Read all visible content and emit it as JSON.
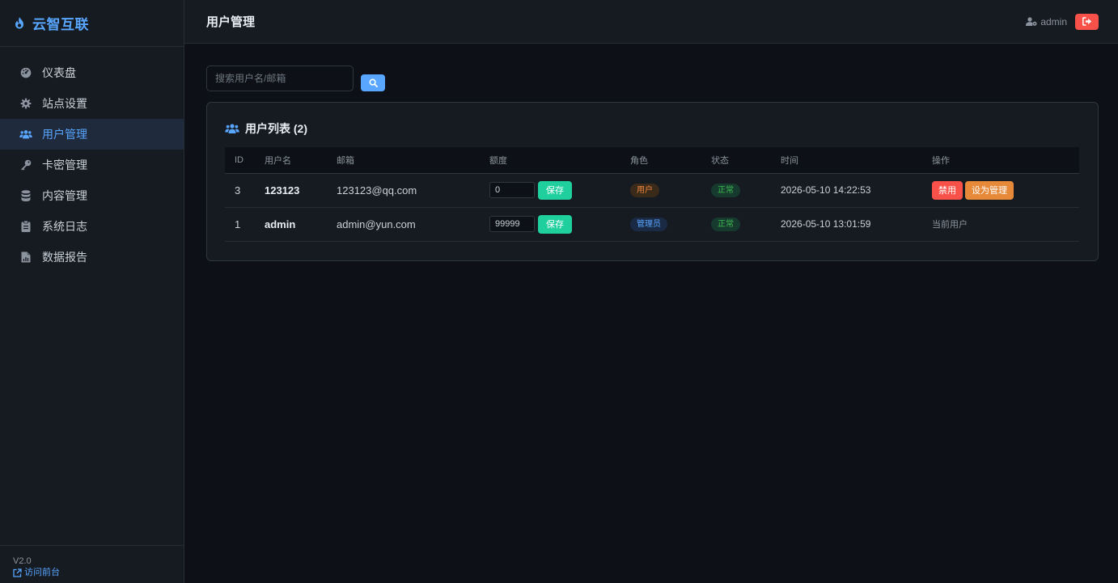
{
  "brand": {
    "name": "云智互联"
  },
  "sidebar": {
    "items": [
      {
        "label": "仪表盘",
        "icon": "dashboard-icon",
        "active": false
      },
      {
        "label": "站点设置",
        "icon": "gear-icon",
        "active": false
      },
      {
        "label": "用户管理",
        "icon": "users-icon",
        "active": true
      },
      {
        "label": "卡密管理",
        "icon": "key-icon",
        "active": false
      },
      {
        "label": "内容管理",
        "icon": "database-icon",
        "active": false
      },
      {
        "label": "系统日志",
        "icon": "clipboard-icon",
        "active": false
      },
      {
        "label": "数据报告",
        "icon": "file-chart-icon",
        "active": false
      }
    ],
    "version": "V2.0",
    "visit_label": "访问前台"
  },
  "header": {
    "title": "用户管理",
    "username": "admin"
  },
  "search": {
    "placeholder": "搜索用户名/邮箱"
  },
  "card": {
    "title": "用户列表 (2)"
  },
  "table": {
    "columns": [
      "ID",
      "用户名",
      "邮箱",
      "额度",
      "角色",
      "状态",
      "时间",
      "操作"
    ],
    "rows": [
      {
        "id": "3",
        "username": "123123",
        "email": "123123@qq.com",
        "quota": "0",
        "save_label": "保存",
        "role": "用户",
        "status": "正常",
        "time": "2026-05-10 14:22:53",
        "action_disable": "禁用",
        "action_setadmin": "设为管理"
      },
      {
        "id": "1",
        "username": "admin",
        "email": "admin@yun.com",
        "quota": "99999",
        "save_label": "保存",
        "role": "管理员",
        "status": "正常",
        "time": "2026-05-10 13:01:59",
        "action_text": "当前用户"
      }
    ]
  },
  "colors": {
    "accent": "#58a6ff",
    "danger": "#f85149",
    "success": "#1fcf9e",
    "warning": "#e68a3a"
  }
}
